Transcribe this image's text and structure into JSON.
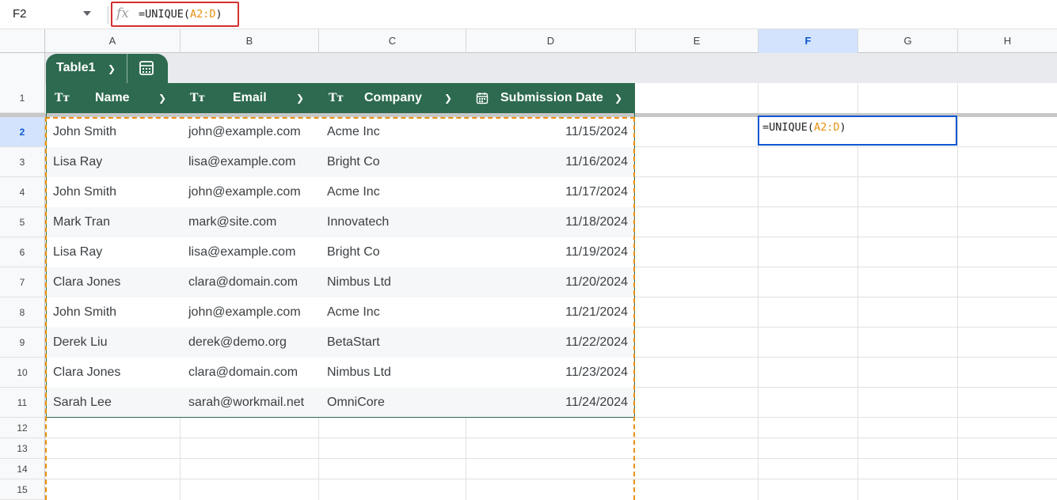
{
  "name_box": {
    "value": "F2"
  },
  "formula_bar": {
    "fx_label": "fx",
    "formula_prefix": "=UNIQUE(",
    "formula_range": "A2:D",
    "formula_suffix": ")"
  },
  "columns": [
    "A",
    "B",
    "C",
    "D",
    "E",
    "F",
    "G",
    "H"
  ],
  "selected_column": "F",
  "rows": [
    "1",
    "2",
    "3",
    "4",
    "5",
    "6",
    "7",
    "8",
    "9",
    "10",
    "11",
    "12",
    "13",
    "14",
    "15"
  ],
  "selected_row": "2",
  "table": {
    "name": "Table1",
    "header_color": "#2d6a4f",
    "headers": [
      {
        "type_icon": "Tт",
        "label": "Name"
      },
      {
        "type_icon": "Tт",
        "label": "Email"
      },
      {
        "type_icon": "Tт",
        "label": "Company"
      },
      {
        "type_icon": "calendar-icon",
        "label": "Submission Date"
      }
    ],
    "data": [
      [
        "John Smith",
        "john@example.com",
        "Acme Inc",
        "11/15/2024"
      ],
      [
        "Lisa Ray",
        "lisa@example.com",
        "Bright Co",
        "11/16/2024"
      ],
      [
        "John Smith",
        "john@example.com",
        "Acme Inc",
        "11/17/2024"
      ],
      [
        "Mark Tran",
        "mark@site.com",
        "Innovatech",
        "11/18/2024"
      ],
      [
        "Lisa Ray",
        "lisa@example.com",
        "Bright Co",
        "11/19/2024"
      ],
      [
        "Clara Jones",
        "clara@domain.com",
        "Nimbus Ltd",
        "11/20/2024"
      ],
      [
        "John Smith",
        "john@example.com",
        "Acme Inc",
        "11/21/2024"
      ],
      [
        "Derek Liu",
        "derek@demo.org",
        "BetaStart",
        "11/22/2024"
      ],
      [
        "Clara Jones",
        "clara@domain.com",
        "Nimbus Ltd",
        "11/23/2024"
      ],
      [
        "Sarah Lee",
        "sarah@workmail.net",
        "OmniCore",
        "11/24/2024"
      ]
    ]
  },
  "active_cell": {
    "ref": "F2",
    "formula_prefix": "=UNIQUE(",
    "formula_range": "A2:D",
    "formula_suffix": ")"
  },
  "colors": {
    "range_highlight": "#e8910f",
    "selection": "#0b57d0",
    "formula_box_border": "#d32f2f"
  }
}
